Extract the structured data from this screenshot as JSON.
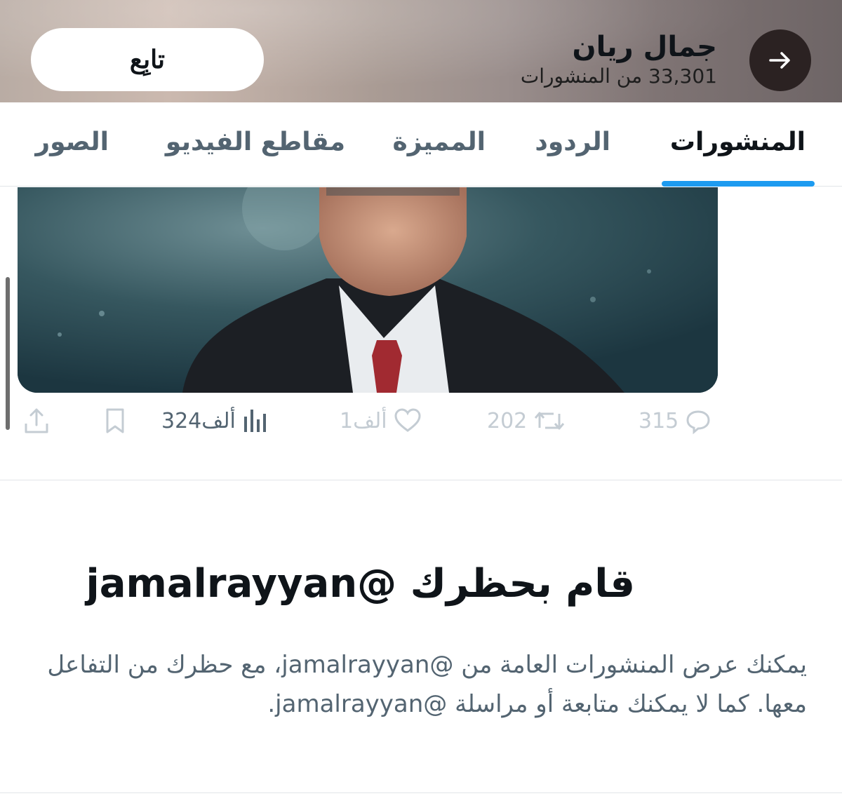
{
  "header": {
    "follow_label": "تابِع",
    "profile_name": "جمال ريان",
    "posts_count": "33,301 من المنشورات",
    "back_icon": "arrow-right-icon"
  },
  "tabs": [
    {
      "label": "المنشورات",
      "active": true
    },
    {
      "label": "الردود",
      "active": false
    },
    {
      "label": "المميزة",
      "active": false
    },
    {
      "label": "مقاطع الفيديو",
      "active": false
    },
    {
      "label": "الصور",
      "active": false
    }
  ],
  "tweet": {
    "replies": "315",
    "reposts": "202",
    "likes": "1ألف",
    "views": "324ألف"
  },
  "blocked": {
    "title": "قام بحظرك @jamalrayyan",
    "body": "يمكنك عرض المنشورات العامة من @jamalrayyan، مع حظرك من التفاعل معها. كما لا يمكنك متابعة أو مراسلة @jamalrayyan."
  },
  "colors": {
    "accent": "#1d9bf0",
    "text_primary": "#0f1419",
    "text_secondary": "#536471"
  }
}
